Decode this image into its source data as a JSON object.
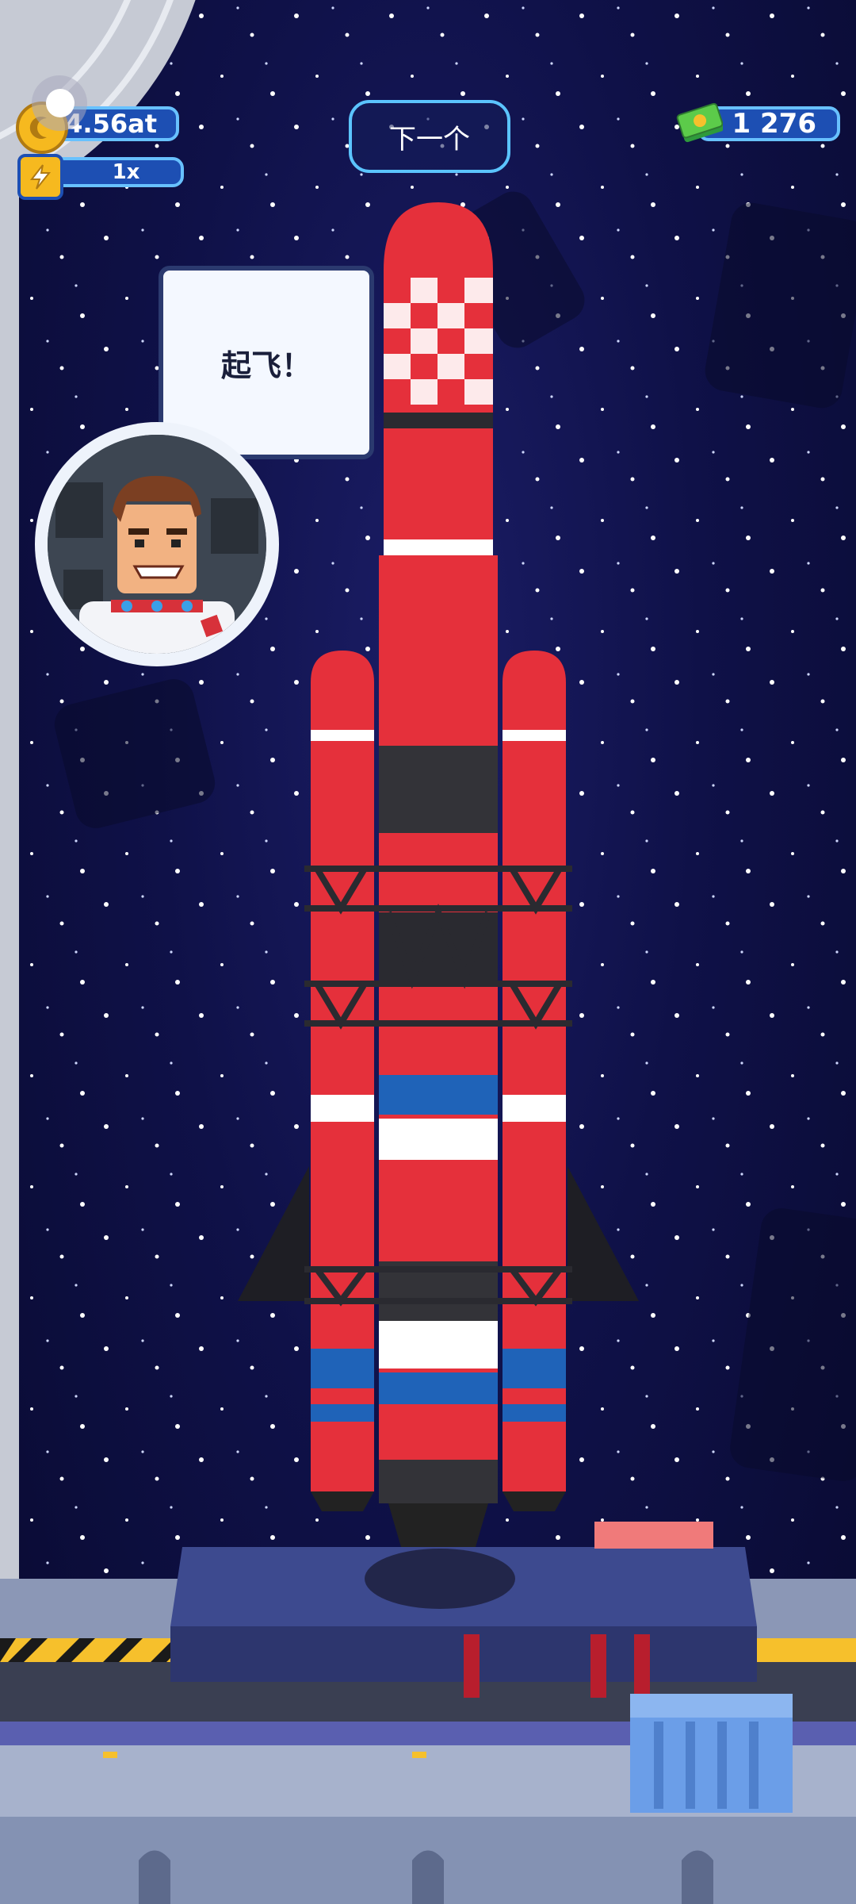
{
  "hud": {
    "altitude_value": "4.56at",
    "speed_multiplier": "1x",
    "cash_value": "1 276"
  },
  "next_button": {
    "label": "下一个"
  },
  "dialog": {
    "speech": "起飞！"
  },
  "icons": {
    "coin": "coin-icon",
    "boost": "lightning-icon",
    "cash": "cash-stack-icon",
    "astronaut": "astronaut-avatar"
  },
  "colors": {
    "rocket_red": "#e5303b",
    "hud_blue": "#1d4fb3",
    "hud_border": "#68c1ff",
    "space": "#0f1148"
  }
}
